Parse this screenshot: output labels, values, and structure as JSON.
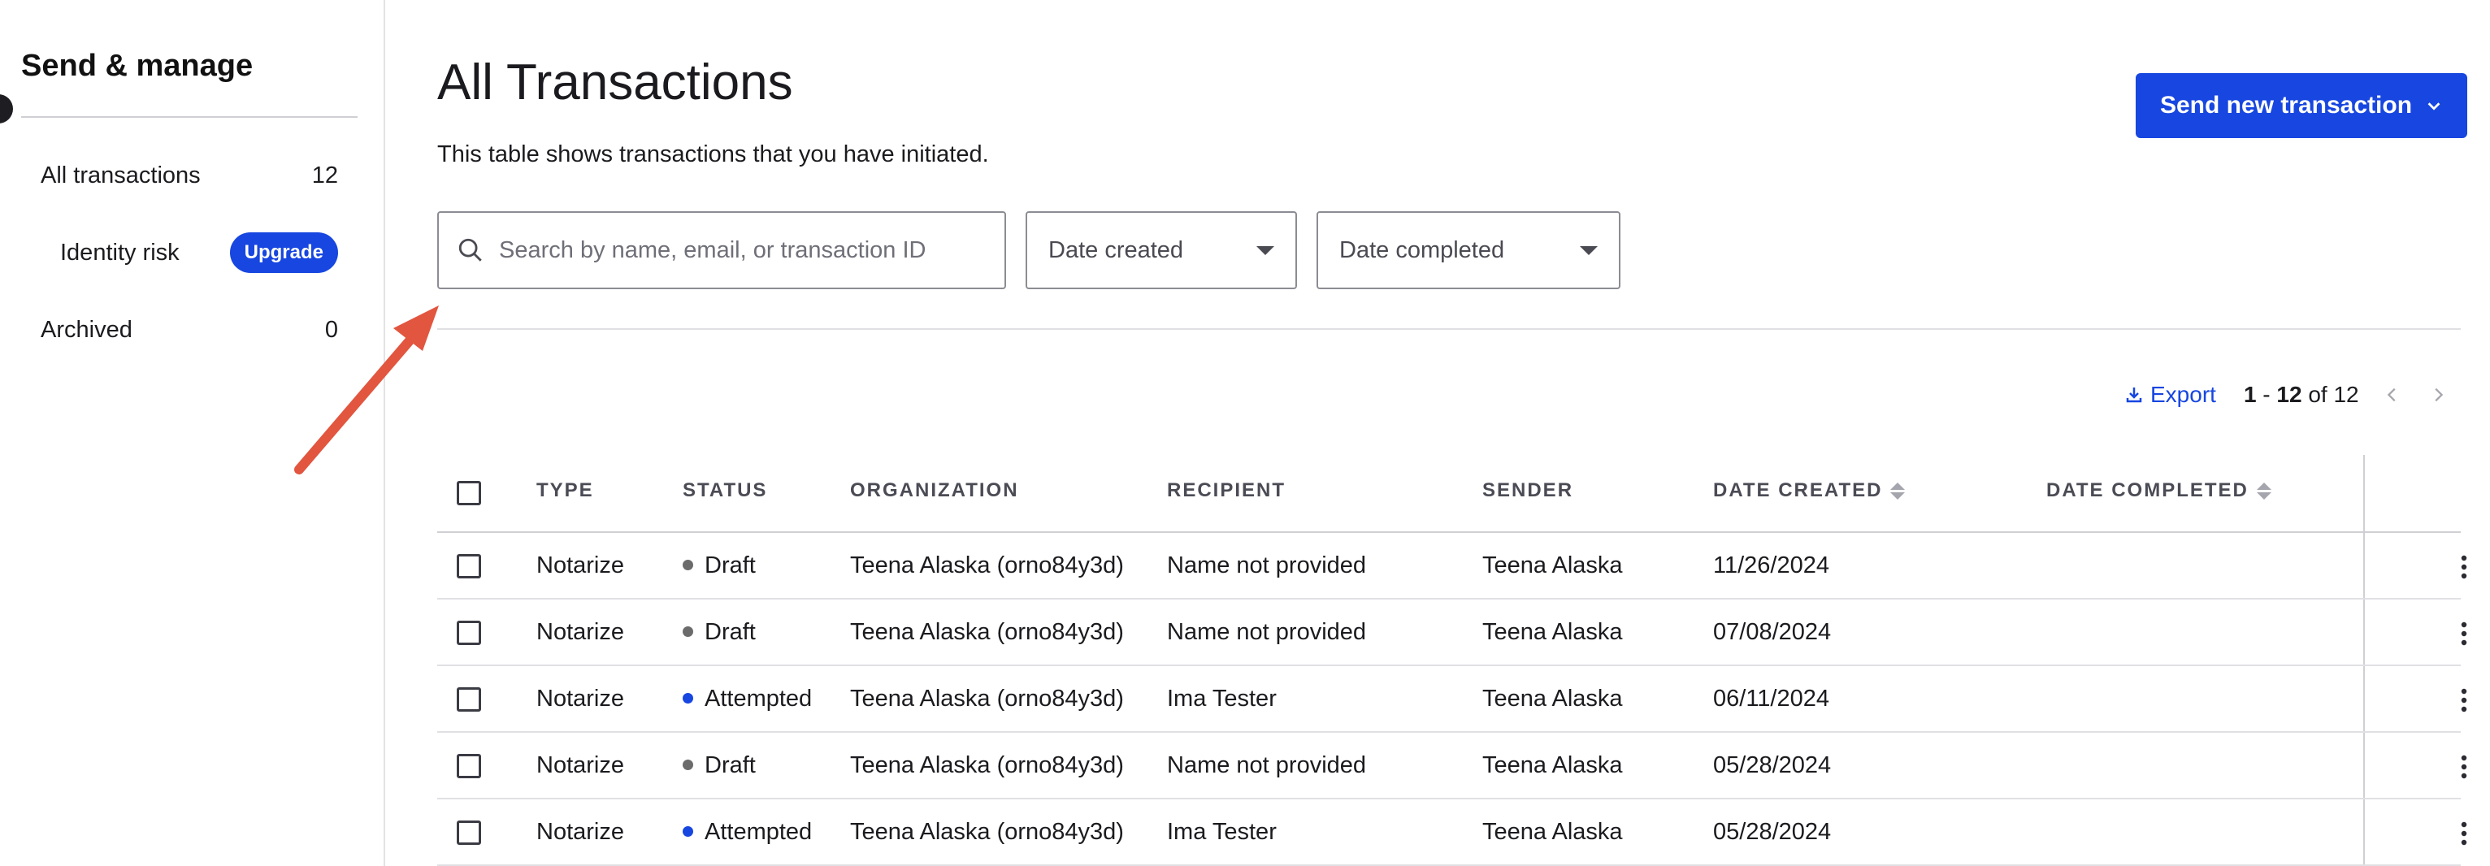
{
  "sidebar": {
    "title": "Send & manage",
    "items": [
      {
        "label": "All transactions",
        "count": "12"
      },
      {
        "label": "Identity risk",
        "badge": "Upgrade"
      },
      {
        "label": "Archived",
        "count": "0"
      }
    ]
  },
  "header": {
    "title": "All Transactions",
    "description": "This table shows transactions that you have initiated.",
    "send_button": "Send new transaction"
  },
  "filters": {
    "search_placeholder": "Search by name, email, or transaction ID",
    "date_created": "Date created",
    "date_completed": "Date completed"
  },
  "toolbar": {
    "export": "Export",
    "range_start": "1",
    "range_sep": " - ",
    "range_end": "12",
    "of_text": " of 12"
  },
  "table": {
    "columns": [
      "TYPE",
      "STATUS",
      "ORGANIZATION",
      "RECIPIENT",
      "SENDER",
      "DATE CREATED",
      "DATE COMPLETED"
    ],
    "rows": [
      {
        "type": "Notarize",
        "status": "Draft",
        "status_color": "#6b6b6b",
        "organization": "Teena Alaska (orno84y3d)",
        "recipient": "Name not provided",
        "sender": "Teena Alaska",
        "date_created": "11/26/2024",
        "date_completed": ""
      },
      {
        "type": "Notarize",
        "status": "Draft",
        "status_color": "#6b6b6b",
        "organization": "Teena Alaska (orno84y3d)",
        "recipient": "Name not provided",
        "sender": "Teena Alaska",
        "date_created": "07/08/2024",
        "date_completed": ""
      },
      {
        "type": "Notarize",
        "status": "Attempted",
        "status_color": "#1746e0",
        "organization": "Teena Alaska (orno84y3d)",
        "recipient": "Ima Tester",
        "sender": "Teena Alaska",
        "date_created": "06/11/2024",
        "date_completed": ""
      },
      {
        "type": "Notarize",
        "status": "Draft",
        "status_color": "#6b6b6b",
        "organization": "Teena Alaska (orno84y3d)",
        "recipient": "Name not provided",
        "sender": "Teena Alaska",
        "date_created": "05/28/2024",
        "date_completed": ""
      },
      {
        "type": "Notarize",
        "status": "Attempted",
        "status_color": "#1746e0",
        "organization": "Teena Alaska (orno84y3d)",
        "recipient": "Ima Tester",
        "sender": "Teena Alaska",
        "date_created": "05/28/2024",
        "date_completed": ""
      }
    ]
  },
  "colors": {
    "accent": "#1746e0",
    "annotation_arrow": "#e2553f",
    "draft_dot": "#6b6b6b",
    "attempted_dot": "#1746e0"
  },
  "icons": {
    "search": "search-icon",
    "caret": "caret-down-icon",
    "export": "download-icon",
    "more": "more-vertical-icon",
    "prev": "chevron-left-icon",
    "next": "chevron-right-icon"
  }
}
